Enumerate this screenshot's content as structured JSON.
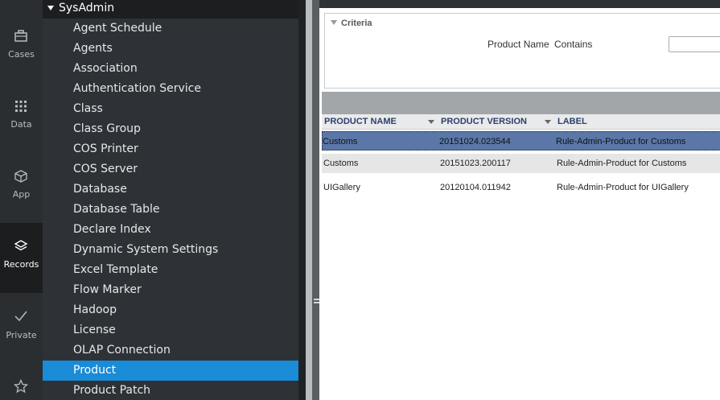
{
  "rail": {
    "items": [
      {
        "label": "Cases",
        "icon": "briefcase-icon",
        "active": false
      },
      {
        "label": "Data",
        "icon": "grid-icon",
        "active": false
      },
      {
        "label": "App",
        "icon": "cube-icon",
        "active": false
      },
      {
        "label": "Records",
        "icon": "layers-icon",
        "active": true
      },
      {
        "label": "Private",
        "icon": "checkmark-icon",
        "active": false
      },
      {
        "label": "",
        "icon": "star-icon",
        "active": false
      }
    ]
  },
  "tree": {
    "header": "SysAdmin",
    "items": [
      "Agent Schedule",
      "Agents",
      "Association",
      "Authentication Service",
      "Class",
      "Class Group",
      "COS Printer",
      "COS Server",
      "Database",
      "Database Table",
      "Declare Index",
      "Dynamic System Settings",
      "Excel Template",
      "Flow Marker",
      "Hadoop",
      "License",
      "OLAP Connection",
      "Product",
      "Product Patch"
    ],
    "selected": "Product"
  },
  "criteria": {
    "title": "Criteria",
    "field": "Product Name",
    "operator": "Contains",
    "value": ""
  },
  "grid": {
    "columns": [
      "PRODUCT NAME",
      "PRODUCT VERSION",
      "LABEL"
    ],
    "rows": [
      {
        "name": "Customs",
        "version": "20151024.023544",
        "label": "Rule-Admin-Product for Customs",
        "selected": true
      },
      {
        "name": "Customs",
        "version": "20151023.200117",
        "label": "Rule-Admin-Product for Customs",
        "selected": false
      },
      {
        "name": "UIGallery",
        "version": "20120104.011942",
        "label": "Rule-Admin-Product for UIGallery",
        "selected": false
      }
    ]
  },
  "colors": {
    "selected_tree": "#1a8bd6",
    "selected_row": "#5a77a8",
    "rail_bg": "#2b2e31",
    "tree_bg": "#2e3236"
  }
}
